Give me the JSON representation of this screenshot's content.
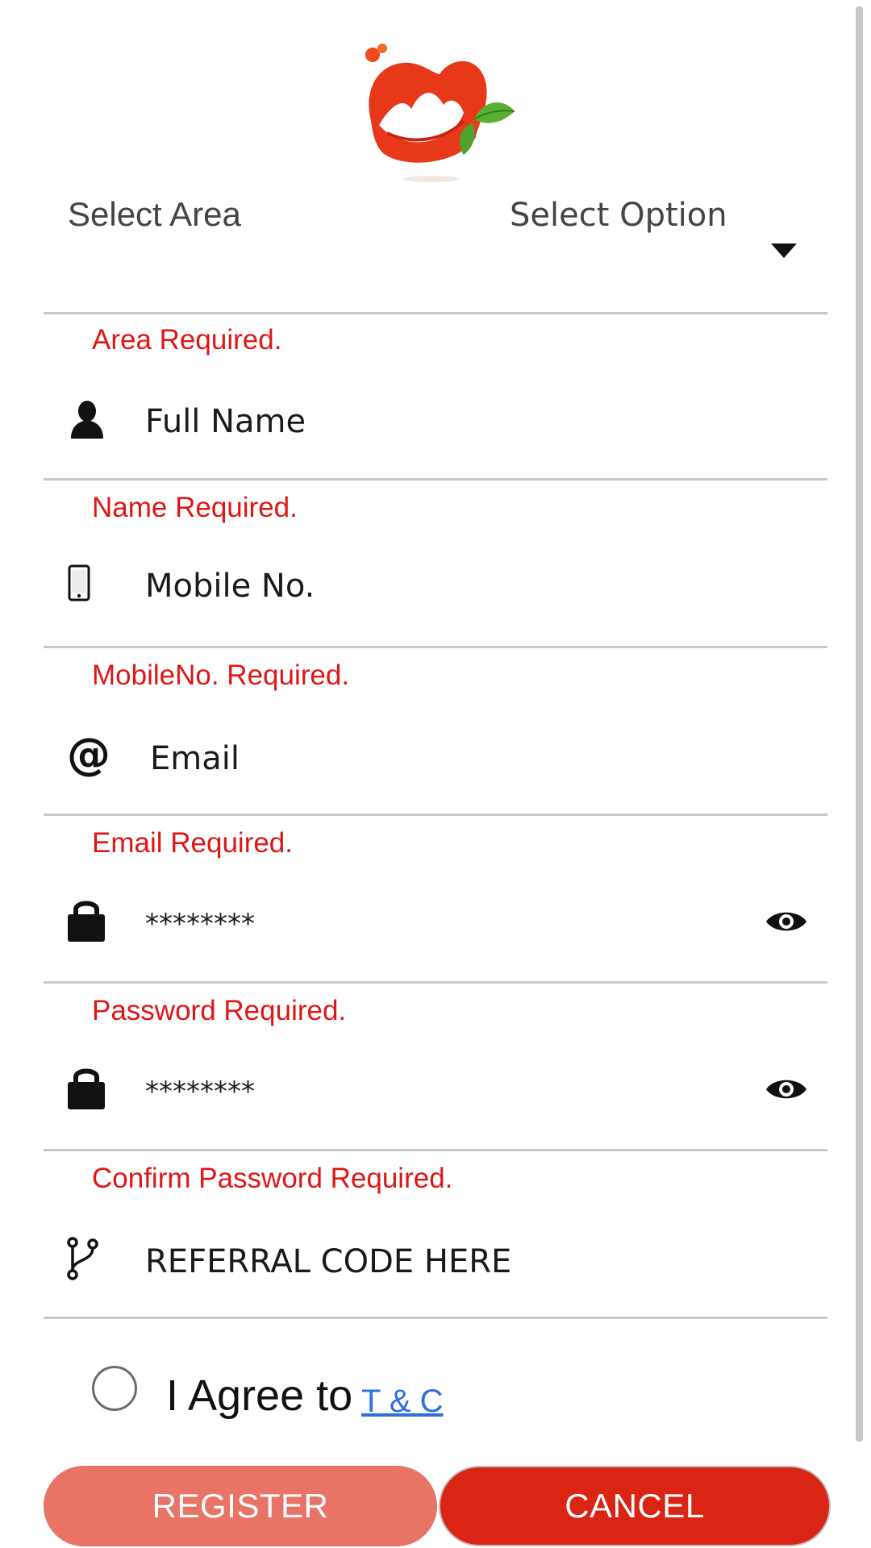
{
  "colors": {
    "error": "#e01616",
    "register_button": "#e87468",
    "cancel_button": "#da2414",
    "link": "#2f6fe0",
    "divider": "#c9c9c9"
  },
  "area": {
    "label": "Select Area",
    "selected": "Select Option",
    "error": "Area Required."
  },
  "full_name": {
    "placeholder": "Full Name",
    "icon": "person-icon",
    "error": "Name Required."
  },
  "mobile": {
    "placeholder": "Mobile No.",
    "icon": "mobile-phone-icon",
    "error": "MobileNo. Required."
  },
  "email": {
    "placeholder": "Email",
    "icon": "at-sign-icon",
    "error": "Email Required."
  },
  "password": {
    "placeholder": "********",
    "icon": "lock-icon",
    "toggle_icon": "eye-icon",
    "error": "Password Required."
  },
  "confirm_password": {
    "placeholder": "********",
    "icon": "lock-icon",
    "toggle_icon": "eye-icon",
    "error": "Confirm Password Required."
  },
  "referral": {
    "placeholder": "REFERRAL CODE HERE",
    "icon": "branch-icon"
  },
  "terms": {
    "agree_text": "I Agree to",
    "link_text": "T & C"
  },
  "buttons": {
    "register": "REGISTER",
    "cancel": "CANCEL"
  }
}
